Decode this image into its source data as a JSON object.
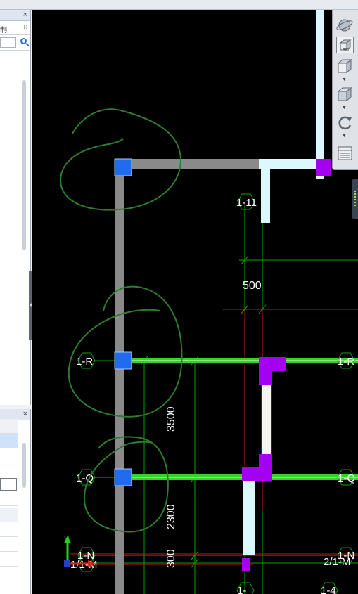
{
  "left_panel_top": {
    "close_label": "×",
    "toolbar_text": "制",
    "more_label": "››",
    "search_placeholder": ""
  },
  "left_panel_bottom": {
    "close_label": "×"
  },
  "view_toolbar": {
    "buttons": [
      {
        "name": "orbit",
        "icon": "orbit-icon"
      },
      {
        "name": "3d-view",
        "icon": "cube-3d-icon",
        "label": "3D"
      },
      {
        "name": "view-cube",
        "icon": "view-cube-icon"
      },
      {
        "name": "box-view",
        "icon": "box-icon"
      },
      {
        "name": "rotate",
        "icon": "rotate-icon"
      },
      {
        "name": "display-settings",
        "icon": "layers-icon"
      }
    ]
  },
  "cad": {
    "colors": {
      "wall": "#8a8a8a",
      "column": "#1f6cf0",
      "beam": "#35d22a",
      "purple": "#a400f2",
      "cyan_wall": "#dcf8ff",
      "axis_green": "#0aa30a",
      "axis_red": "#c81414",
      "annotation": "#2e7d2e"
    },
    "axis_labels": {
      "a_1_11": "1-11",
      "a_1_R_left": "1-R",
      "a_1_R_right": "1-R",
      "a_1_Q_left": "1-Q",
      "a_1_Q_right": "1-Q",
      "a_1_N_left": "1-N",
      "a_1_M_left": "1/1-M",
      "a_1_N_right": "1-N",
      "a_1_M_right": "2/1-M",
      "a_1_4": "1-4",
      "a_bottom_partial": "1-"
    },
    "dimensions": {
      "d500": "500",
      "d3500": "3500",
      "d2300": "2300",
      "d300": "300"
    },
    "ucs_icon": "ucs-axis-icon"
  }
}
